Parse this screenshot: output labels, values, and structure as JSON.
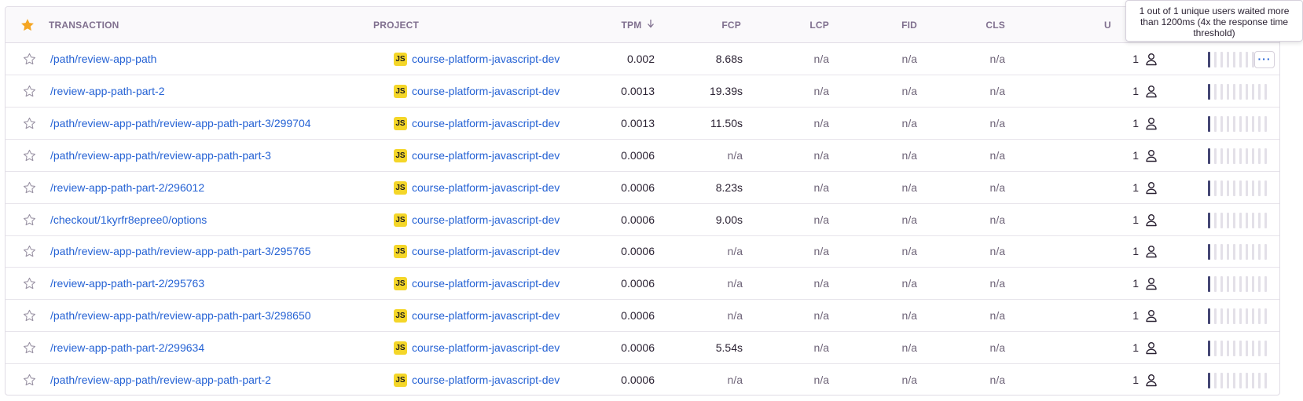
{
  "header": {
    "transaction": "TRANSACTION",
    "project": "PROJECT",
    "tpm": "TPM",
    "tpm_sort_icon": "arrow-down-icon",
    "fcp": "FCP",
    "lcp": "LCP",
    "fid": "FID",
    "cls": "CLS",
    "users": "U"
  },
  "tooltip": {
    "text": "1 out of 1 unique users waited more than 1200ms (4x the response time threshold)"
  },
  "colors": {
    "link": "#2562d4",
    "star_header": "#f5a623",
    "spark_on": "#444674",
    "spark_off": "#e3e0e8",
    "js_badge": "#f4d629"
  },
  "rows": [
    {
      "transaction": "/path/review-app-path",
      "project": "course-platform-javascript-dev",
      "project_badge": "JS",
      "tpm": "0.002",
      "fcp": "8.68s",
      "lcp": "n/a",
      "fid": "n/a",
      "cls": "n/a",
      "users": "1"
    },
    {
      "transaction": "/review-app-path-part-2",
      "project": "course-platform-javascript-dev",
      "project_badge": "JS",
      "tpm": "0.0013",
      "fcp": "19.39s",
      "lcp": "n/a",
      "fid": "n/a",
      "cls": "n/a",
      "users": "1"
    },
    {
      "transaction": "/path/review-app-path/review-app-path-part-3/299704",
      "project": "course-platform-javascript-dev",
      "project_badge": "JS",
      "tpm": "0.0013",
      "fcp": "11.50s",
      "lcp": "n/a",
      "fid": "n/a",
      "cls": "n/a",
      "users": "1"
    },
    {
      "transaction": "/path/review-app-path/review-app-path-part-3",
      "project": "course-platform-javascript-dev",
      "project_badge": "JS",
      "tpm": "0.0006",
      "fcp": "n/a",
      "lcp": "n/a",
      "fid": "n/a",
      "cls": "n/a",
      "users": "1"
    },
    {
      "transaction": "/review-app-path-part-2/296012",
      "project": "course-platform-javascript-dev",
      "project_badge": "JS",
      "tpm": "0.0006",
      "fcp": "8.23s",
      "lcp": "n/a",
      "fid": "n/a",
      "cls": "n/a",
      "users": "1"
    },
    {
      "transaction": "/checkout/1kyrfr8epree0/options",
      "project": "course-platform-javascript-dev",
      "project_badge": "JS",
      "tpm": "0.0006",
      "fcp": "9.00s",
      "lcp": "n/a",
      "fid": "n/a",
      "cls": "n/a",
      "users": "1"
    },
    {
      "transaction": "/path/review-app-path/review-app-path-part-3/295765",
      "project": "course-platform-javascript-dev",
      "project_badge": "JS",
      "tpm": "0.0006",
      "fcp": "n/a",
      "lcp": "n/a",
      "fid": "n/a",
      "cls": "n/a",
      "users": "1"
    },
    {
      "transaction": "/review-app-path-part-2/295763",
      "project": "course-platform-javascript-dev",
      "project_badge": "JS",
      "tpm": "0.0006",
      "fcp": "n/a",
      "lcp": "n/a",
      "fid": "n/a",
      "cls": "n/a",
      "users": "1"
    },
    {
      "transaction": "/path/review-app-path/review-app-path-part-3/298650",
      "project": "course-platform-javascript-dev",
      "project_badge": "JS",
      "tpm": "0.0006",
      "fcp": "n/a",
      "lcp": "n/a",
      "fid": "n/a",
      "cls": "n/a",
      "users": "1"
    },
    {
      "transaction": "/review-app-path-part-2/299634",
      "project": "course-platform-javascript-dev",
      "project_badge": "JS",
      "tpm": "0.0006",
      "fcp": "5.54s",
      "lcp": "n/a",
      "fid": "n/a",
      "cls": "n/a",
      "users": "1"
    },
    {
      "transaction": "/path/review-app-path/review-app-path-part-2",
      "project": "course-platform-javascript-dev",
      "project_badge": "JS",
      "tpm": "0.0006",
      "fcp": "n/a",
      "lcp": "n/a",
      "fid": "n/a",
      "cls": "n/a",
      "users": "1"
    }
  ]
}
